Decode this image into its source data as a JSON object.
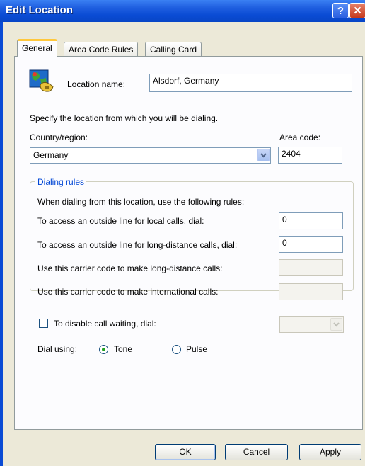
{
  "window": {
    "title": "Edit Location",
    "help_label": "?",
    "close_label": "✕"
  },
  "tabs": [
    {
      "label": "General",
      "active": true
    },
    {
      "label": "Area Code Rules",
      "active": false
    },
    {
      "label": "Calling Card",
      "active": false
    }
  ],
  "general": {
    "location_name_label": "Location name:",
    "location_name_value": "Alsdorf, Germany",
    "specify_text": "Specify the location from which you will be dialing.",
    "country_label": "Country/region:",
    "country_value": "Germany",
    "area_code_label": "Area code:",
    "area_code_value": "2404"
  },
  "dialing_rules": {
    "legend": "Dialing rules",
    "intro": "When dialing from this location, use the following rules:",
    "local_label": "To access an outside line for local calls, dial:",
    "local_value": "0",
    "long_distance_label": "To access an outside line for long-distance calls, dial:",
    "long_distance_value": "0",
    "carrier_ld_label": "Use this carrier code to make long-distance calls:",
    "carrier_ld_value": "",
    "carrier_intl_label": "Use this carrier code to make international calls:",
    "carrier_intl_value": ""
  },
  "call_waiting": {
    "label": "To disable call waiting, dial:",
    "checked": false,
    "value": ""
  },
  "dial_using": {
    "label": "Dial using:",
    "tone_label": "Tone",
    "pulse_label": "Pulse",
    "selected": "Tone"
  },
  "buttons": {
    "ok": "OK",
    "cancel": "Cancel",
    "apply": "Apply"
  },
  "colors": {
    "title_bar": "#0A4BD4",
    "dialog_bg": "#ECE9D8",
    "group_legend": "#0046D5",
    "tab_highlight": "#FFC83C"
  }
}
